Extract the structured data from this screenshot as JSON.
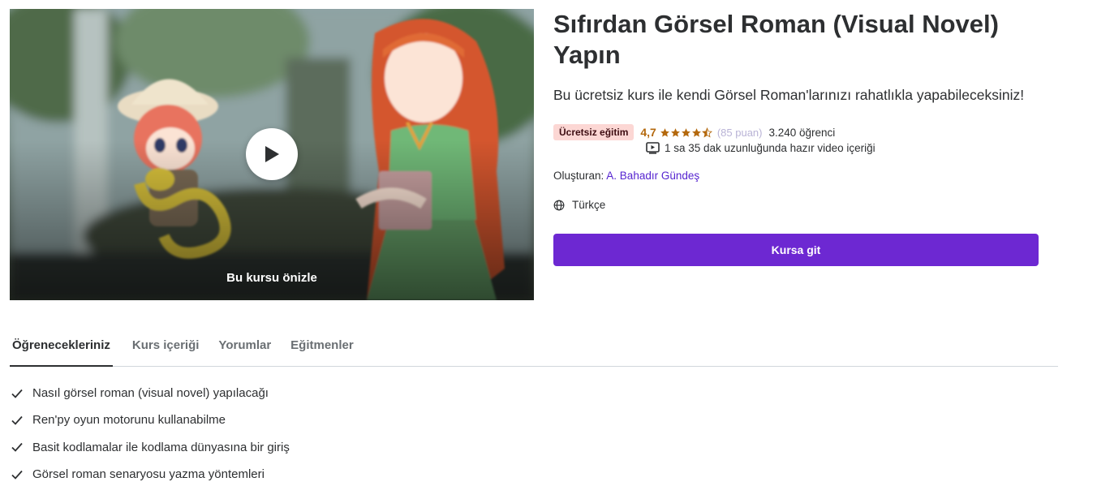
{
  "preview": {
    "label": "Bu kursu önizle",
    "play_icon": "play-icon"
  },
  "course": {
    "title": "Sıfırdan Görsel Roman (Visual Novel) Yapın",
    "headline": "Bu ücretsiz kurs ile kendi Görsel Roman'larınızı rahatlıkla yapabileceksiniz!",
    "badge": "Ücretsiz eğitim",
    "rating": "4,7",
    "rating_value": 4.7,
    "rating_count": "(85 puan)",
    "students": "3.240 öğrenci",
    "video_info": "1 sa 35 dak uzunluğunda hazır video içeriği",
    "author_label": "Oluşturan:",
    "author_name": "A. Bahadır Gündeş",
    "language": "Türkçe",
    "cta_label": "Kursa git"
  },
  "tabs": [
    {
      "label": "Öğrenecekleriniz",
      "active": true
    },
    {
      "label": "Kurs içeriği",
      "active": false
    },
    {
      "label": "Yorumlar",
      "active": false
    },
    {
      "label": "Eğitmenler",
      "active": false
    }
  ],
  "learn_items": [
    "Nasıl görsel roman (visual novel) yapılacağı",
    "Ren'py oyun motorunu kullanabilme",
    "Basit kodlamalar ile kodlama dünyasına bir giriş",
    "Görsel roman senaryosu yazma yöntemleri"
  ],
  "colors": {
    "accent": "#6d28d2",
    "rating": "#b4690e",
    "badge_bg": "#fcd7d4",
    "link": "#5624d0"
  }
}
